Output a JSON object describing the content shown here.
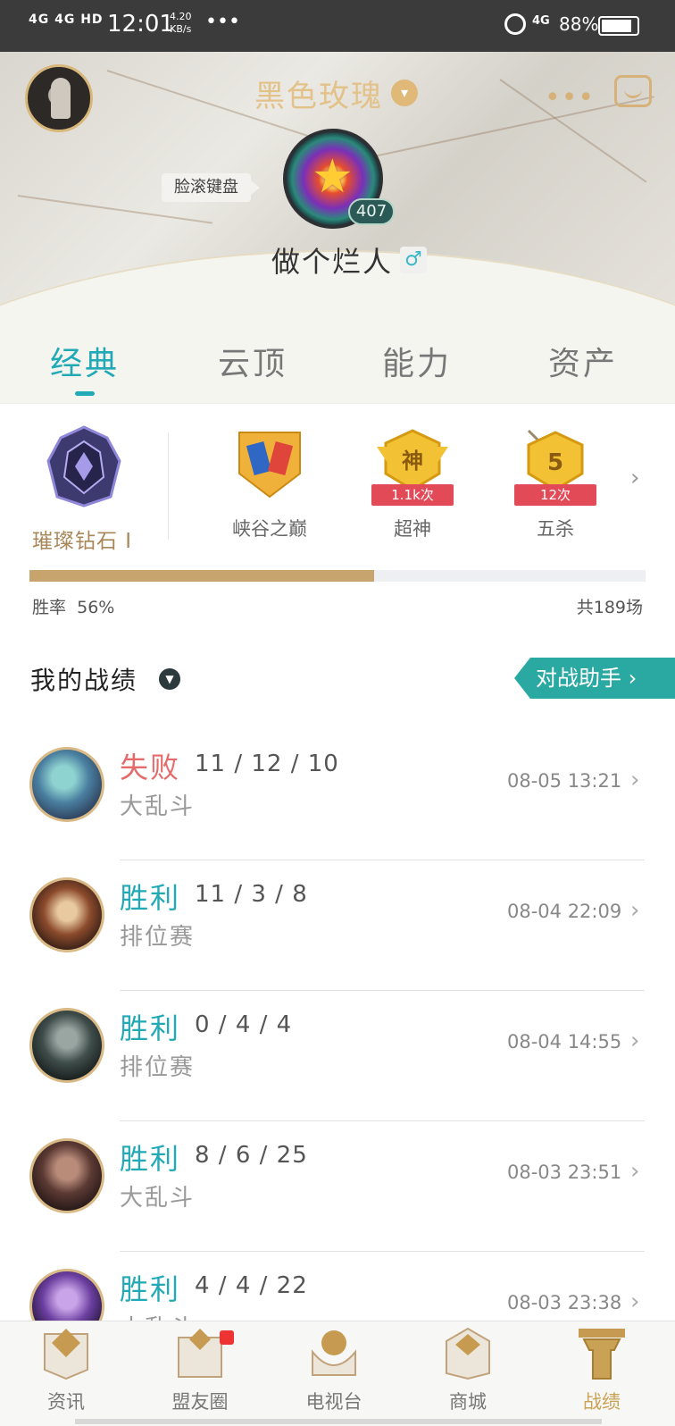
{
  "status_bar": {
    "network": "4G 4G HD",
    "time": "12:01",
    "speed_value": "4.20",
    "speed_unit": "KB/s",
    "dots": "•••",
    "network2": "4G",
    "battery": "88%",
    "battery_level": 0.88
  },
  "header": {
    "title": "黑色玫瑰",
    "tag": "脸滚键盘",
    "level": "407",
    "nickname": "做个烂人",
    "gender_symbol": "♂",
    "more": "•••"
  },
  "tabs": [
    {
      "label": "经典",
      "active": true
    },
    {
      "label": "云顶",
      "active": false
    },
    {
      "label": "能力",
      "active": false
    },
    {
      "label": "资产",
      "active": false
    }
  ],
  "honors": {
    "rank": "璀璨钻石 I",
    "items": [
      {
        "label": "峡谷之巅",
        "count": ""
      },
      {
        "label": "超神",
        "count": "1.1k次",
        "badge_char": "神"
      },
      {
        "label": "五杀",
        "count": "12次",
        "badge_char": "5"
      }
    ]
  },
  "stats": {
    "winrate_label": "胜率",
    "winrate_value": "56%",
    "winrate_fraction": 0.56,
    "total": "共189场"
  },
  "records": {
    "title": "我的战绩",
    "assistant_label": "对战助手",
    "chevron": "›",
    "matches": [
      {
        "result": "失败",
        "outcome": "loss",
        "kda": "11 / 12 / 10",
        "mode": "大乱斗",
        "time": "08-05 13:21"
      },
      {
        "result": "胜利",
        "outcome": "win",
        "kda": "11 / 3 / 8",
        "mode": "排位赛",
        "time": "08-04 22:09"
      },
      {
        "result": "胜利",
        "outcome": "win",
        "kda": "0 / 4 / 4",
        "mode": "排位赛",
        "time": "08-04 14:55"
      },
      {
        "result": "胜利",
        "outcome": "win",
        "kda": "8 / 6 / 25",
        "mode": "大乱斗",
        "time": "08-03 23:51"
      },
      {
        "result": "胜利",
        "outcome": "win",
        "kda": "4 / 4 / 22",
        "mode": "大乱斗",
        "time": "08-03 23:38"
      }
    ]
  },
  "bottom_nav": [
    {
      "label": "资讯",
      "icon": "news-icon",
      "active": false
    },
    {
      "label": "盟友圈",
      "icon": "friends-icon",
      "active": false
    },
    {
      "label": "电视台",
      "icon": "tv-icon",
      "active": false
    },
    {
      "label": "商城",
      "icon": "store-icon",
      "active": false
    },
    {
      "label": "战绩",
      "icon": "records-icon",
      "active": true
    }
  ],
  "colors": {
    "accent": "#22a9b6",
    "gold": "#caa255",
    "loss": "#e56b6b",
    "winbar": "#c7a36d"
  }
}
